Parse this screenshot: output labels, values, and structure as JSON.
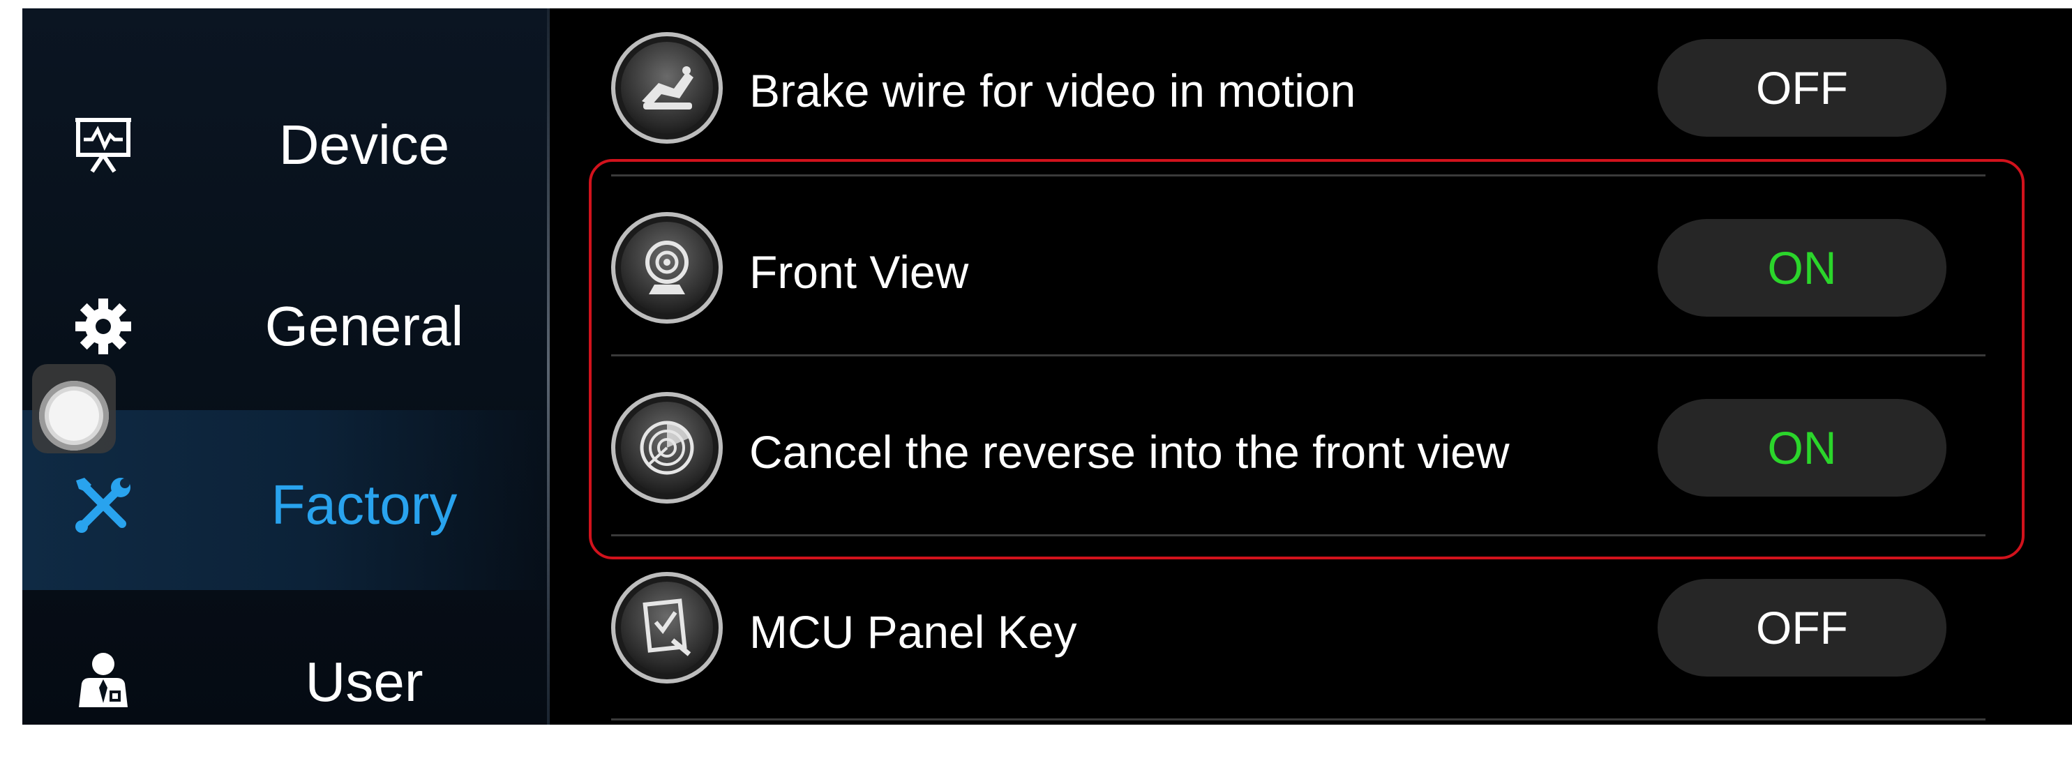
{
  "sidebar": {
    "items": [
      {
        "label": "Device",
        "icon": "presentation-chart-icon",
        "selected": false
      },
      {
        "label": "General",
        "icon": "gear-icon",
        "selected": false
      },
      {
        "label": "Factory",
        "icon": "tools-icon",
        "selected": true
      },
      {
        "label": "User",
        "icon": "user-icon",
        "selected": false
      }
    ]
  },
  "settings": {
    "rows": [
      {
        "label": "Brake wire for video in motion",
        "icon": "brake-icon",
        "value": "OFF"
      },
      {
        "label": "Front View",
        "icon": "camera-icon",
        "value": "ON"
      },
      {
        "label": "Cancel the reverse into the front view",
        "icon": "radar-icon",
        "value": "ON"
      },
      {
        "label": "MCU Panel Key",
        "icon": "panel-key-icon",
        "value": "OFF"
      }
    ]
  },
  "colors": {
    "accent": "#29a3ee",
    "on": "#2bd52b",
    "off": "#ffffff",
    "highlight": "#d1121c",
    "toggle_bg": "#262626"
  }
}
